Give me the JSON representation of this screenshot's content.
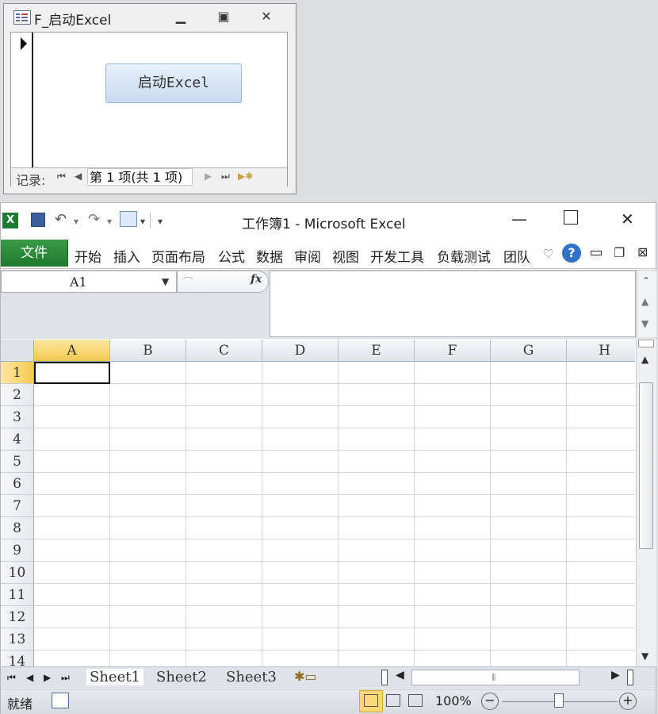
{
  "access_form": {
    "title": "F_启动Excel",
    "button_label": "启动Excel",
    "nav_label": "记录:",
    "nav_position": "第 1 项(共 1 项)"
  },
  "excel": {
    "title": "工作簿1 - Microsoft Excel",
    "file_tab": "文件",
    "tabs": [
      "开始",
      "插入",
      "页面布局",
      "公式",
      "数据",
      "审阅",
      "视图",
      "开发工具",
      "负载测试",
      "团队"
    ],
    "name_box": "A1",
    "fx_label": "fx",
    "columns": [
      "A",
      "B",
      "C",
      "D",
      "E",
      "F",
      "G",
      "H"
    ],
    "rows": [
      "1",
      "2",
      "3",
      "4",
      "5",
      "6",
      "7",
      "8",
      "9",
      "10",
      "11",
      "12",
      "13",
      "14"
    ],
    "sheets": [
      "Sheet1",
      "Sheet2",
      "Sheet3"
    ],
    "status_text": "就绪",
    "zoom": "100%"
  },
  "colors": {
    "file_tab_green": "#1e7a2c",
    "active_header": "#f6c94e",
    "button_blue": "#c9daf2"
  },
  "icons": [
    "minimize-icon",
    "maximize-icon",
    "close-icon",
    "excel-logo-icon",
    "save-icon",
    "undo-icon",
    "redo-icon",
    "help-icon"
  ]
}
